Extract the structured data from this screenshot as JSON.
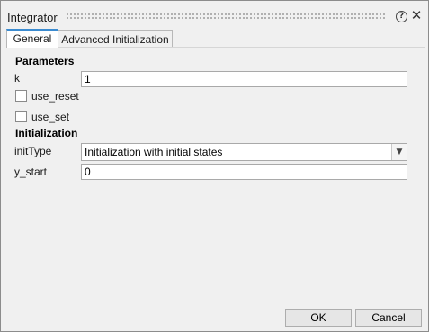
{
  "window": {
    "title": "Integrator"
  },
  "tabs": [
    {
      "label": "General",
      "active": true
    },
    {
      "label": "Advanced Initialization",
      "active": false
    }
  ],
  "parameters": {
    "section_title": "Parameters",
    "k": {
      "label": "k",
      "value": "1"
    },
    "use_reset": {
      "label": "use_reset",
      "checked": false
    },
    "use_set": {
      "label": "use_set",
      "checked": false
    }
  },
  "initialization": {
    "section_title": "Initialization",
    "initType": {
      "label": "initType",
      "selected": "Initialization with initial states"
    },
    "y_start": {
      "label": "y_start",
      "value": "0"
    }
  },
  "buttons": {
    "ok": "OK",
    "cancel": "Cancel"
  },
  "icons": {
    "help": "help-circle-icon",
    "close": "close-icon",
    "dropdown": "chevron-down-icon"
  },
  "colors": {
    "active_tab_accent": "#3b8bd0",
    "dialog_bg": "#f0f0f0"
  }
}
